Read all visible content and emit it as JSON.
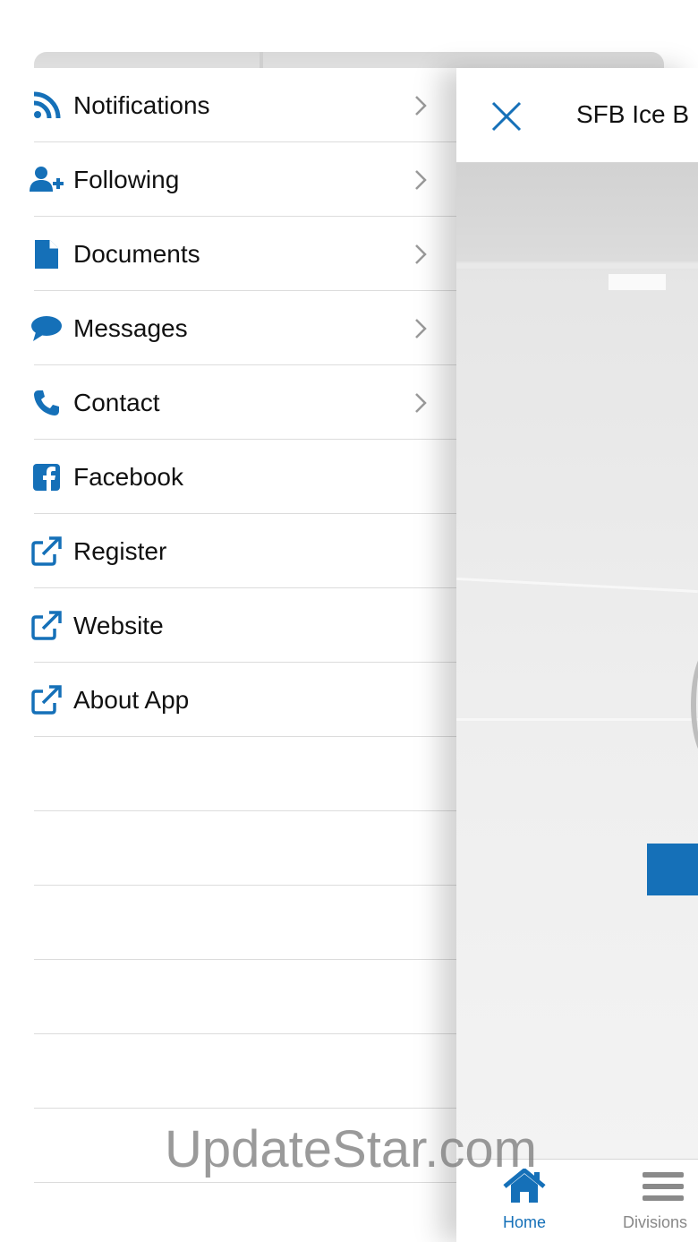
{
  "menu": {
    "items": [
      {
        "label": "Notifications",
        "icon": "rss-icon",
        "chevron": true
      },
      {
        "label": "Following",
        "icon": "user-plus-icon",
        "chevron": true
      },
      {
        "label": "Documents",
        "icon": "document-icon",
        "chevron": true
      },
      {
        "label": "Messages",
        "icon": "chat-bubble-icon",
        "chevron": true
      },
      {
        "label": "Contact",
        "icon": "phone-icon",
        "chevron": true
      },
      {
        "label": "Facebook",
        "icon": "facebook-icon",
        "chevron": false
      },
      {
        "label": "Register",
        "icon": "external-link-icon",
        "chevron": false
      },
      {
        "label": "Website",
        "icon": "external-link-icon",
        "chevron": false
      },
      {
        "label": "About App",
        "icon": "external-link-icon",
        "chevron": false
      }
    ]
  },
  "header": {
    "title": "SFB Ice B"
  },
  "tabbar": {
    "home_label": "Home",
    "divisions_label": "Divisions"
  },
  "watermark": "UpdateStar.com",
  "colors": {
    "accent": "#1570b8",
    "chevron": "#9a9a9a",
    "separator": "#dcdcdc"
  }
}
